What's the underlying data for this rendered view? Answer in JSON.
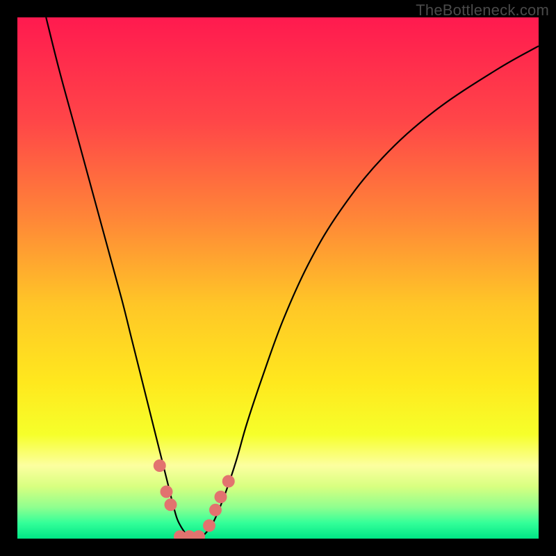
{
  "watermark": "TheBottleneck.com",
  "chart_data": {
    "type": "line",
    "title": "",
    "xlabel": "",
    "ylabel": "",
    "xlim": [
      0,
      100
    ],
    "ylim": [
      0,
      100
    ],
    "grid": false,
    "legend": false,
    "background_gradient": {
      "stops": [
        {
          "offset": 0.0,
          "color": "#ff1a4f"
        },
        {
          "offset": 0.2,
          "color": "#ff4648"
        },
        {
          "offset": 0.38,
          "color": "#ff8438"
        },
        {
          "offset": 0.55,
          "color": "#ffc627"
        },
        {
          "offset": 0.7,
          "color": "#ffe81e"
        },
        {
          "offset": 0.8,
          "color": "#f6ff2a"
        },
        {
          "offset": 0.86,
          "color": "#fcffa0"
        },
        {
          "offset": 0.9,
          "color": "#d8ff80"
        },
        {
          "offset": 0.94,
          "color": "#8fff8f"
        },
        {
          "offset": 0.97,
          "color": "#33ff99"
        },
        {
          "offset": 1.0,
          "color": "#00e585"
        }
      ]
    },
    "series": [
      {
        "name": "curve",
        "color": "#000000",
        "x": [
          5.5,
          8,
          11,
          14,
          17,
          20,
          22,
          24,
          26,
          27.5,
          29,
          30,
          31,
          33,
          35,
          36.5,
          38,
          40,
          42,
          44,
          47,
          51,
          56,
          62,
          70,
          80,
          92,
          100
        ],
        "y": [
          100,
          90,
          79,
          68,
          57,
          46,
          38,
          30,
          22,
          16,
          10,
          6,
          3,
          0.3,
          0.3,
          1.5,
          4,
          9,
          15,
          22,
          31,
          42,
          53,
          63,
          73,
          82,
          90,
          94.5
        ]
      }
    ],
    "markers": {
      "name": "threshold-dots",
      "color": "#e2736f",
      "radius_pct": 1.2,
      "points": [
        {
          "x": 27.3,
          "y": 14
        },
        {
          "x": 28.6,
          "y": 9
        },
        {
          "x": 29.4,
          "y": 6.5
        },
        {
          "x": 31.2,
          "y": 0.4
        },
        {
          "x": 33.0,
          "y": 0.4
        },
        {
          "x": 34.8,
          "y": 0.4
        },
        {
          "x": 36.8,
          "y": 2.5
        },
        {
          "x": 38.0,
          "y": 5.5
        },
        {
          "x": 39.0,
          "y": 8
        },
        {
          "x": 40.5,
          "y": 11
        }
      ]
    }
  }
}
